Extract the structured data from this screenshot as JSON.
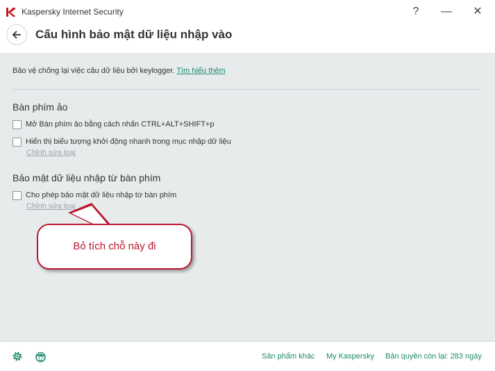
{
  "window": {
    "app_title": "Kaspersky Internet Security",
    "help_symbol": "?",
    "minimize_symbol": "—",
    "close_symbol": "✕"
  },
  "header": {
    "title": "Cấu hình bảo mật dữ liệu nhập vào"
  },
  "intro": {
    "text": "Bảo vệ chống lại việc câu dữ liệu bởi keylogger. ",
    "link": "Tìm hiểu thêm"
  },
  "virtual_keyboard": {
    "title": "Bàn phím ảo",
    "options": [
      {
        "label": "Mở Bàn phím ảo bằng cách nhấn CTRL+ALT+SHIFT+p",
        "checked": false
      },
      {
        "label": "Hiển thị biểu tượng khởi động nhanh trong mục nhập dữ liệu",
        "checked": false
      }
    ],
    "edit_link": "Chỉnh sửa loại"
  },
  "keyboard_protection": {
    "title": "Bảo mật dữ liệu nhập từ bàn phím",
    "options": [
      {
        "label": "Cho phép bảo mật dữ liệu nhập từ bàn phím",
        "checked": false
      }
    ],
    "edit_link": "Chỉnh sửa loại"
  },
  "callout": {
    "text": "Bỏ tích chỗ này đi"
  },
  "footer": {
    "other_products": "Sản phẩm khác",
    "my_kaspersky": "My Kaspersky",
    "license_status": "Bản quyền còn lại: 283 ngày"
  },
  "colors": {
    "accent": "#1a8a6c",
    "brand_red": "#b8172c",
    "content_bg": "#e8ebec"
  },
  "icons": [
    "kaspersky-logo-icon",
    "back-arrow-icon",
    "settings-gear-icon",
    "support-agent-icon"
  ]
}
